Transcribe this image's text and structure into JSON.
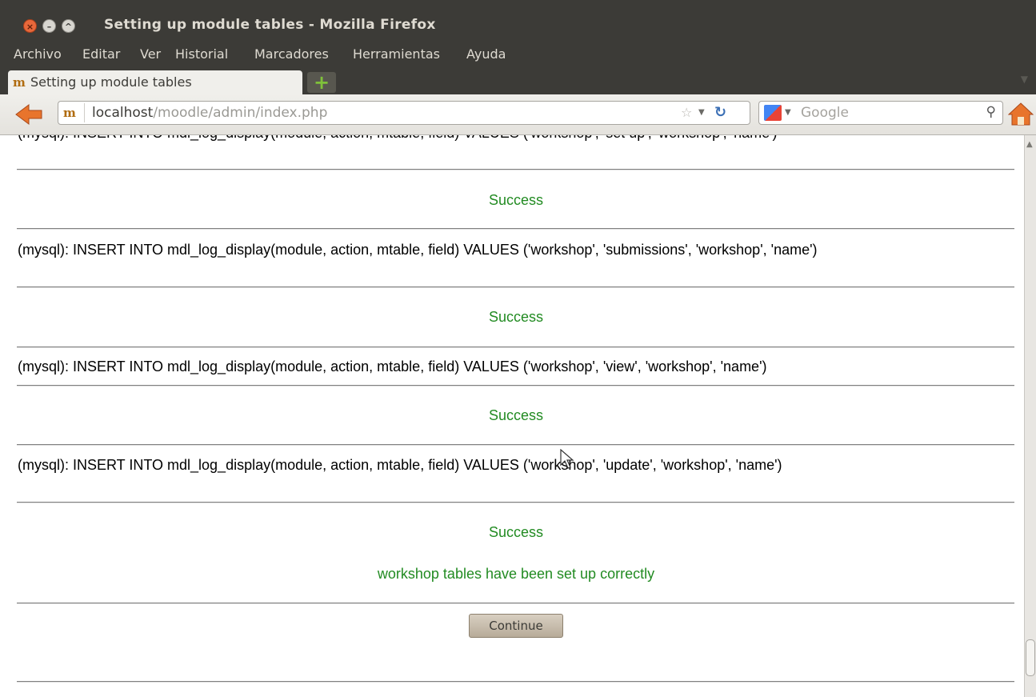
{
  "window": {
    "title": "Setting up module tables - Mozilla Firefox",
    "controls": [
      "close",
      "minimize",
      "maximize"
    ]
  },
  "menubar": {
    "items": [
      "Archivo",
      "Editar",
      "Ver",
      "Historial",
      "Marcadores",
      "Herramientas",
      "Ayuda"
    ]
  },
  "tabs": [
    {
      "label": "Setting up module tables",
      "favicon": "moodle-icon",
      "active": true
    }
  ],
  "navbar": {
    "url_host": "localhost",
    "url_path": "/moodle/admin/index.php",
    "search_placeholder": "Google",
    "search_engine_icon": "google-icon"
  },
  "content": {
    "top_sql_partial": "(mysql): INSERT INTO mdl_log_display(module, action, mtable, field) VALUES ('workshop', 'set up', 'workshop', 'name')",
    "entries": [
      {
        "result": "Success"
      },
      {
        "sql": "(mysql): INSERT INTO mdl_log_display(module, action, mtable, field) VALUES ('workshop', 'submissions', 'workshop', 'name')",
        "result": "Success"
      },
      {
        "sql": "(mysql): INSERT INTO mdl_log_display(module, action, mtable, field) VALUES ('workshop', 'view', 'workshop', 'name')",
        "result": "Success"
      },
      {
        "sql": "(mysql): INSERT INTO mdl_log_display(module, action, mtable, field) VALUES ('workshop', 'update', 'workshop', 'name')",
        "result": "Success"
      }
    ],
    "final_message": "workshop tables have been set up correctly",
    "continue_label": "Continue"
  },
  "colors": {
    "success": "#228b22",
    "titlebar": "#3c3b37",
    "close_button": "#e8683b"
  }
}
